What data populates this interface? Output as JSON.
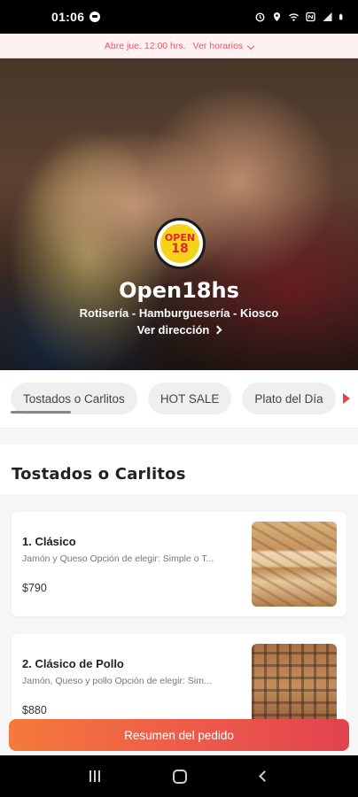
{
  "status_bar": {
    "time": "01:06",
    "icons": [
      "circle-notification-icon",
      "alarm-icon",
      "location-icon",
      "wifi-icon",
      "nfc-icon",
      "signal-icon",
      "battery-icon"
    ]
  },
  "hours_bar": {
    "text": "Abre jue. 12:00 hrs.",
    "link": "Ver horarios",
    "color": "#e45c67"
  },
  "store": {
    "logo_top": "OPEN",
    "logo_bottom": "18",
    "name": "Open18hs",
    "categories": "Rotisería - Hamburguesería - Kiosco",
    "address_link": "Ver dirección"
  },
  "tabs": [
    {
      "label": "Tostados o Carlitos",
      "active": true
    },
    {
      "label": "HOT SALE",
      "active": false
    },
    {
      "label": "Plato del Día",
      "active": false
    }
  ],
  "section": {
    "title": "Tostados o Carlitos"
  },
  "products": [
    {
      "name": "1. Clásico",
      "description": "Jamón y Queso Opción de elegir: Simple o T...",
      "price": "$790"
    },
    {
      "name": "2. Clásico de Pollo",
      "description": "Jamón, Queso y pollo Opción de elegir: Sim...",
      "price": "$880"
    }
  ],
  "cta": {
    "label": "Resumen del pedido",
    "gradient": [
      "#f47a3b",
      "#e2434f"
    ]
  },
  "navbar": {
    "icons": [
      "recents-icon",
      "home-icon",
      "back-icon"
    ]
  }
}
